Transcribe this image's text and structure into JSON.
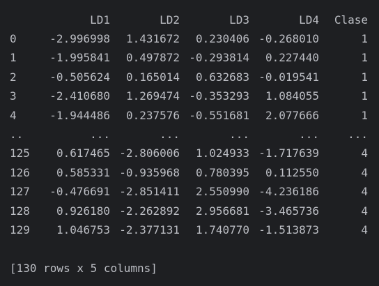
{
  "columns": [
    "LD1",
    "LD2",
    "LD3",
    "LD4",
    "Clase"
  ],
  "rows": [
    {
      "index": "0",
      "ld1": "-2.996998",
      "ld2": "1.431672",
      "ld3": "0.230406",
      "ld4": "-0.268010",
      "clase": "1"
    },
    {
      "index": "1",
      "ld1": "-1.995841",
      "ld2": "0.497872",
      "ld3": "-0.293814",
      "ld4": "0.227440",
      "clase": "1"
    },
    {
      "index": "2",
      "ld1": "-0.505624",
      "ld2": "0.165014",
      "ld3": "0.632683",
      "ld4": "-0.019541",
      "clase": "1"
    },
    {
      "index": "3",
      "ld1": "-2.410680",
      "ld2": "1.269474",
      "ld3": "-0.353293",
      "ld4": "1.084055",
      "clase": "1"
    },
    {
      "index": "4",
      "ld1": "-1.944486",
      "ld2": "0.237576",
      "ld3": "-0.551681",
      "ld4": "2.077666",
      "clase": "1"
    },
    {
      "index": "..",
      "ld1": "...",
      "ld2": "...",
      "ld3": "...",
      "ld4": "...",
      "clase": "..."
    },
    {
      "index": "125",
      "ld1": "0.617465",
      "ld2": "-2.806006",
      "ld3": "1.024933",
      "ld4": "-1.717639",
      "clase": "4"
    },
    {
      "index": "126",
      "ld1": "0.585331",
      "ld2": "-0.935968",
      "ld3": "0.780395",
      "ld4": "0.112550",
      "clase": "4"
    },
    {
      "index": "127",
      "ld1": "-0.476691",
      "ld2": "-2.851411",
      "ld3": "2.550990",
      "ld4": "-4.236186",
      "clase": "4"
    },
    {
      "index": "128",
      "ld1": "0.926180",
      "ld2": "-2.262892",
      "ld3": "2.956681",
      "ld4": "-3.465736",
      "clase": "4"
    },
    {
      "index": "129",
      "ld1": "1.046753",
      "ld2": "-2.377131",
      "ld3": "1.740770",
      "ld4": "-1.513873",
      "clase": "4"
    }
  ],
  "summary": "[130 rows x 5 columns]"
}
